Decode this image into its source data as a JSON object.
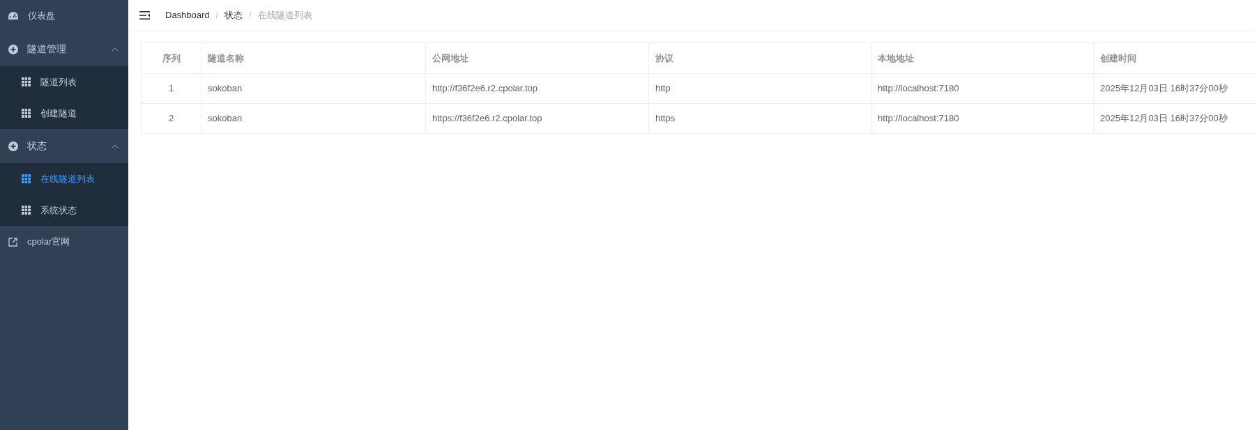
{
  "sidebar": {
    "items": [
      {
        "kind": "dashboard",
        "label": "仪表盘"
      },
      {
        "kind": "group",
        "label": "隧道管理",
        "expanded": true,
        "children": [
          {
            "label": "隧道列表",
            "selected": false
          },
          {
            "label": "创建隧道",
            "selected": false
          }
        ]
      },
      {
        "kind": "group",
        "label": "状态",
        "expanded": true,
        "children": [
          {
            "label": "在线隧道列表",
            "selected": true
          },
          {
            "label": "系统状态",
            "selected": false
          }
        ]
      },
      {
        "kind": "external",
        "label": "cpolar官网"
      }
    ]
  },
  "breadcrumb": {
    "separator": "/",
    "items": [
      "Dashboard",
      "状态",
      "在线隧道列表"
    ]
  },
  "table": {
    "columns": [
      "序列",
      "隧道名称",
      "公网地址",
      "协议",
      "本地地址",
      "创建时间"
    ],
    "rows": [
      [
        "1",
        "sokoban",
        "http://f36f2e6.r2.cpolar.top",
        "http",
        "http://localhost:7180",
        "2025年12月03日 16时37分00秒"
      ],
      [
        "2",
        "sokoban",
        "https://f36f2e6.r2.cpolar.top",
        "https",
        "http://localhost:7180",
        "2025年12月03日 16时37分00秒"
      ]
    ]
  }
}
